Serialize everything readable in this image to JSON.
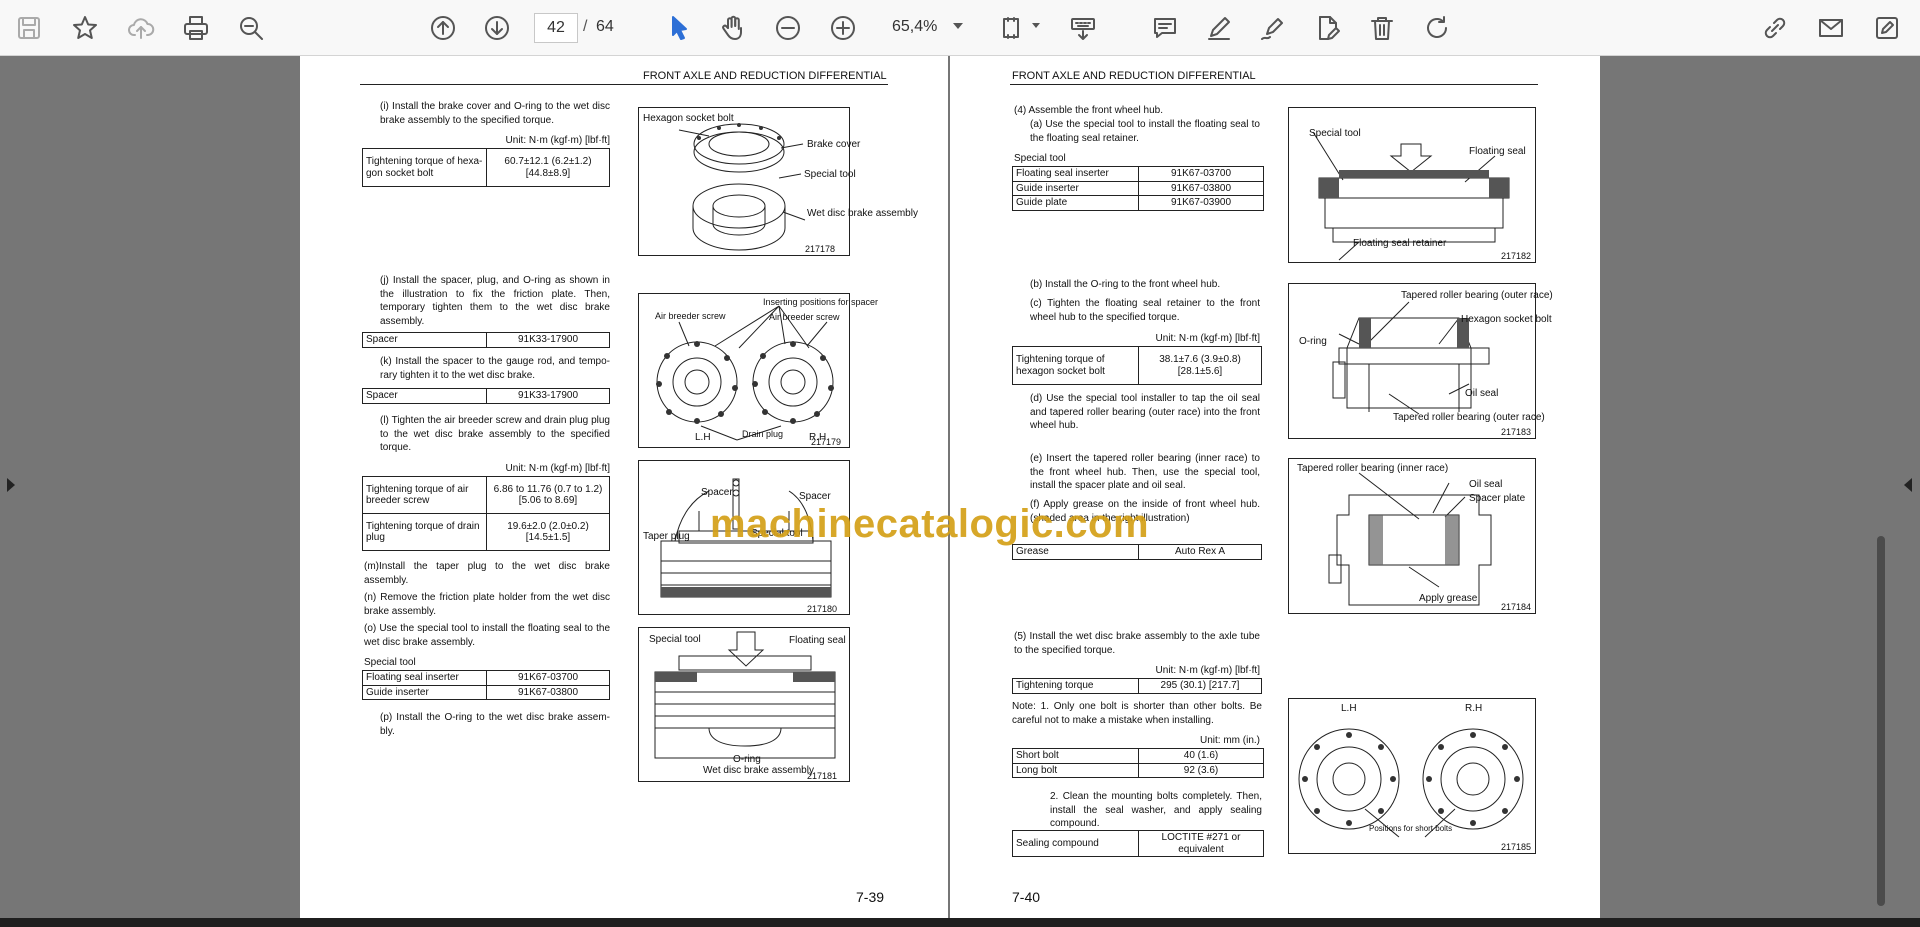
{
  "toolbar": {
    "icons": [
      "save-icon",
      "star-icon",
      "cloud-upload-icon",
      "print-icon",
      "zoom-search-icon",
      "arrow-up-circle-icon",
      "arrow-down-circle-icon",
      "cursor-icon",
      "hand-icon",
      "zoom-out-icon",
      "zoom-in-icon",
      "fit-page-icon",
      "keyboard-icon",
      "comment-icon",
      "pen-icon",
      "sign-icon",
      "edit-pdf-icon",
      "trash-icon",
      "rotate-icon",
      "share-link-icon",
      "email-icon",
      "pen-square-icon"
    ],
    "page_current": "42",
    "page_separator": "/",
    "page_total": "64",
    "zoom": "65,4%"
  },
  "watermark": "machinecatalogic.com",
  "left_page": {
    "header": "FRONT AXLE AND REDUCTION DIFFERENTIAL",
    "page_number": "7-39",
    "step_i": "(i)  Install the brake cover and O-ring to the wet disc brake assembly to the specified torque.",
    "unit_1": "Unit: N·m (kgf·m) [lbf·ft]",
    "torque_1": {
      "label": "Tightening torque of hexa-gon socket bolt",
      "value": "60.7±12.1 (6.2±1.2) [44.8±8.9]"
    },
    "step_j": "(j)  Install the spacer, plug, and O-ring as shown in the illustration to fix the friction plate. Then, temporary tighten them to the wet disc brake assembly.",
    "spacer_1": {
      "label": "Spacer",
      "value": "91K33-17900"
    },
    "step_k": "(k)  Install the spacer to the gauge rod, and tempo-rary tighten it to the wet disc brake.",
    "spacer_2": {
      "label": "Spacer",
      "value": "91K33-17900"
    },
    "step_l": "(l)  Tighten the air breeder screw and drain plug plug to the wet disc brake assembly to the specified torque.",
    "unit_2": "Unit: N·m (kgf·m) [lbf·ft]",
    "torque_2": [
      {
        "label": "Tightening torque of air breeder screw",
        "value": "6.86 to 11.76 (0.7 to 1.2) [5.06 to 8.69]"
      },
      {
        "label": "Tightening torque of drain plug",
        "value": "19.6±2.0 (2.0±0.2) [14.5±1.5]"
      }
    ],
    "step_m": "(m)Install the taper plug to the wet disc brake assembly.",
    "step_n": "(n)  Remove the friction plate holder from the wet disc brake assembly.",
    "step_o": "(o)  Use the special tool to install the floating seal to the wet disc brake assembly.",
    "special_tool_heading": "Special tool",
    "special_tools": [
      {
        "label": "Floating seal inserter",
        "value": "91K67-03700"
      },
      {
        "label": "Guide inserter",
        "value": "91K67-03800"
      }
    ],
    "step_p": "(p)  Install the O-ring to the wet disc brake assem-bly.",
    "fig1": {
      "hexagon": "Hexagon socket bolt",
      "brake_cover": "Brake cover",
      "special_tool": "Special tool",
      "wet_disc": "Wet disc brake assembly",
      "number": "217178"
    },
    "fig2": {
      "inserting": "Inserting positions for spacer",
      "air_left": "Air breeder screw",
      "air_right": "Air breeder screw",
      "lh": "L.H",
      "drain": "Drain plug",
      "rh": "R.H",
      "number": "217179"
    },
    "fig3": {
      "spacer_left": "Spacer",
      "spacer_right": "Spacer",
      "taper_plug": "Taper plug",
      "special_tool": "Special tool",
      "number": "217180"
    },
    "fig4": {
      "special_tool": "Special tool",
      "floating_seal": "Floating seal",
      "oring": "O-ring",
      "wet_disc": "Wet disc brake assembly",
      "number": "217181"
    }
  },
  "right_page": {
    "header": "FRONT AXLE AND REDUCTION DIFFERENTIAL",
    "page_number": "7-40",
    "step_4": "(4)  Assemble the front wheel hub.",
    "step_a": "(a)  Use the special tool to install the floating seal to the floating seal retainer.",
    "special_tool_heading": "Special tool",
    "special_tools": [
      {
        "label": "Floating seal inserter",
        "value": "91K67-03700"
      },
      {
        "label": "Guide inserter",
        "value": "91K67-03800"
      },
      {
        "label": "Guide plate",
        "value": "91K67-03900"
      }
    ],
    "step_b": "(b)  Install the O-ring to the front wheel hub.",
    "step_c": "(c)  Tighten the floating seal retainer to the front wheel hub to the specified torque.",
    "unit_1": "Unit: N·m (kgf·m) [lbf·ft]",
    "torque_1": {
      "label": "Tightening torque of hexagon socket bolt",
      "value": "38.1±7.6 (3.9±0.8) [28.1±5.6]"
    },
    "step_d": "(d)  Use the special tool installer to tap the oil seal and tapered roller bearing (outer race) into the front wheel hub.",
    "step_e": "(e)  Insert the tapered roller bearing (inner race) to the front wheel hub. Then, use the special tool, install the spacer plate and oil seal.",
    "step_f": "(f)  Apply grease on the inside of front wheel hub. (shaded area in the right illustration)",
    "grease": {
      "label": "Grease",
      "value": "Auto Rex A"
    },
    "step_5": "(5)  Install the wet disc brake assembly to the axle tube to the specified torque.",
    "unit_2": "Unit: N·m (kgf·m) [lbf·ft]",
    "torque_2": {
      "label": "Tightening torque",
      "value": "295 (30.1) [217.7]"
    },
    "note_1": "Note: 1.  Only one bolt is shorter than other bolts. Be careful not to make a mistake when installing.",
    "unit_3": "Unit: mm (in.)",
    "bolts": [
      {
        "label": "Short bolt",
        "value": "40 (1.6)"
      },
      {
        "label": "Long bolt",
        "value": "92 (3.6)"
      }
    ],
    "note_2": "2.  Clean the mounting bolts completely. Then, install the seal washer, and apply sealing compound.",
    "sealing": {
      "label": "Sealing compound",
      "value": "LOCTITE #271 or equivalent"
    },
    "fig5": {
      "special_tool": "Special tool",
      "floating_seal": "Floating seal",
      "retainer": "Floating seal retainer",
      "number": "217182"
    },
    "fig6": {
      "tapered_outer": "Tapered roller bearing (outer race)",
      "hexagon": "Hexagon socket bolt",
      "oring": "O-ring",
      "oil_seal": "Oil seal",
      "tapered_outer2": "Tapered roller bearing (outer race)",
      "number": "217183"
    },
    "fig7": {
      "tapered_inner": "Tapered roller bearing (inner race)",
      "oil_seal": "Oil seal",
      "spacer_plate": "Spacer plate",
      "apply_grease": "Apply grease",
      "number": "217184"
    },
    "fig8": {
      "lh": "L.H",
      "rh": "R.H",
      "positions": "Positions for short bolts",
      "number": "217185"
    }
  }
}
